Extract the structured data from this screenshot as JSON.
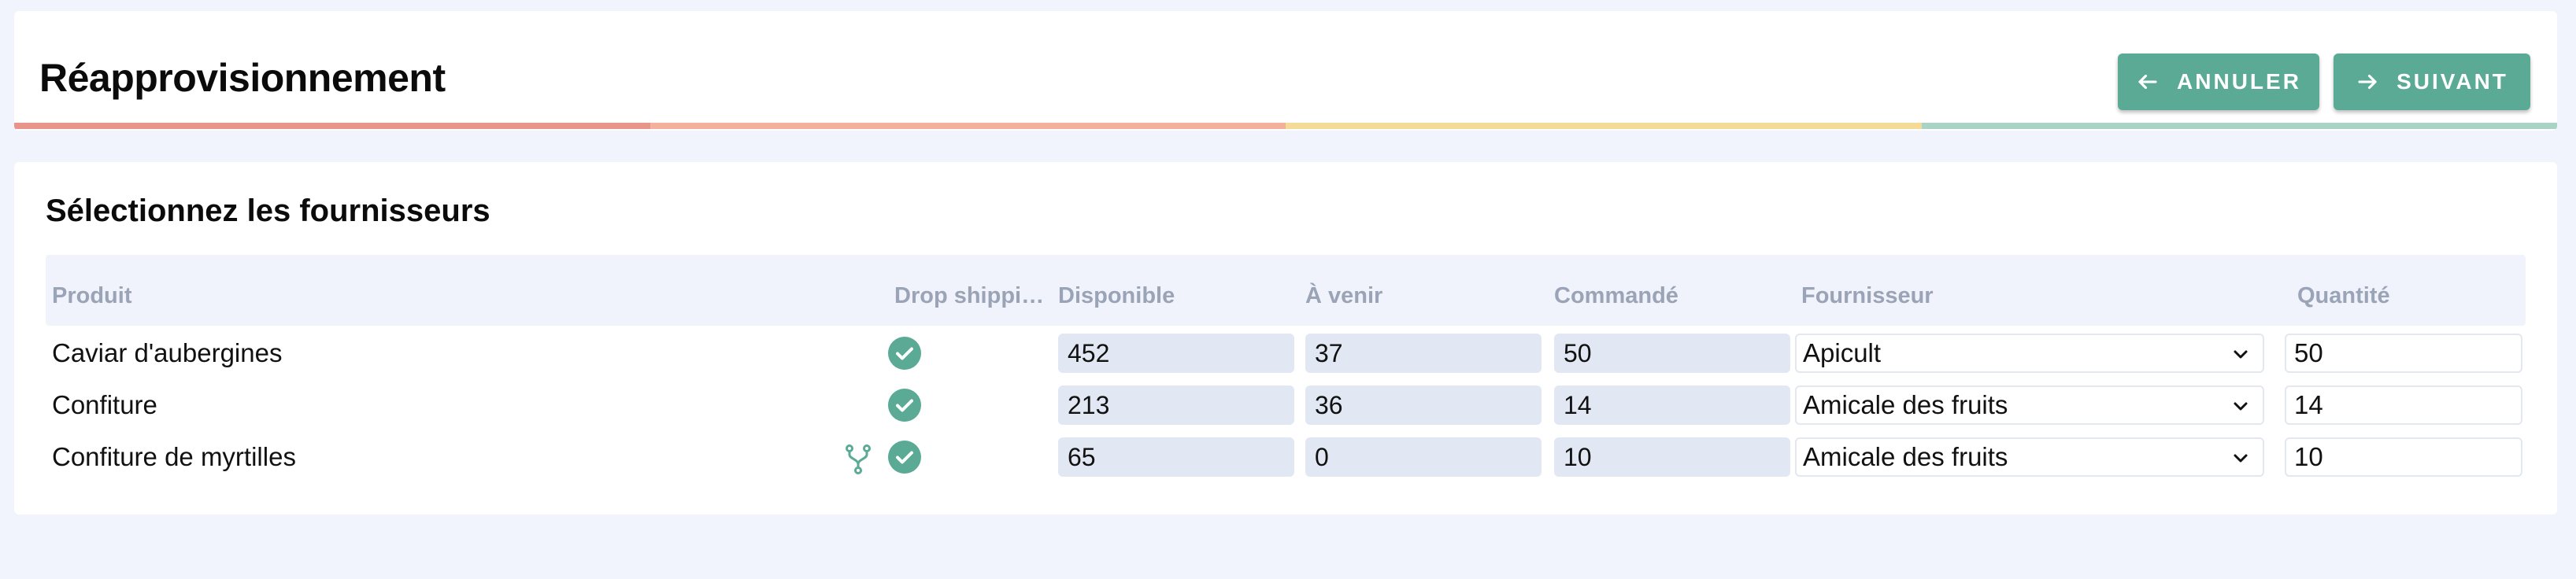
{
  "header": {
    "title": "Réapprovisionnement",
    "cancel_label": "ANNULER",
    "next_label": "SUIVANT",
    "progress_colors": [
      "#e8948a",
      "#f2b19a",
      "#f4dc98",
      "#a8d3c5"
    ]
  },
  "section": {
    "title": "Sélectionnez les fournisseurs"
  },
  "table": {
    "columns": {
      "product": "Produit",
      "dropship": "Drop shippi…",
      "available": "Disponible",
      "upcoming": "À venir",
      "ordered": "Commandé",
      "supplier": "Fournisseur",
      "quantity": "Quantité"
    },
    "rows": [
      {
        "product": "Caviar d'aubergines",
        "has_branch_icon": false,
        "dropship": "check-circle-icon",
        "available": "452",
        "upcoming": "37",
        "ordered": "50",
        "supplier": "Apicult",
        "quantity": "50"
      },
      {
        "product": "Confiture",
        "has_branch_icon": false,
        "dropship": "check-circle-icon",
        "available": "213",
        "upcoming": "36",
        "ordered": "14",
        "supplier": "Amicale des fruits",
        "quantity": "14"
      },
      {
        "product": "Confiture de myrtilles",
        "has_branch_icon": true,
        "dropship": "check-circle-icon",
        "available": "65",
        "upcoming": "0",
        "ordered": "10",
        "supplier": "Amicale des fruits",
        "quantity": "10"
      }
    ]
  },
  "colors": {
    "accent": "#5aaa95",
    "header_text": "#9aa4b6",
    "readonly_bg": "#e2e8f3",
    "page_bg": "#f1f4fc"
  }
}
